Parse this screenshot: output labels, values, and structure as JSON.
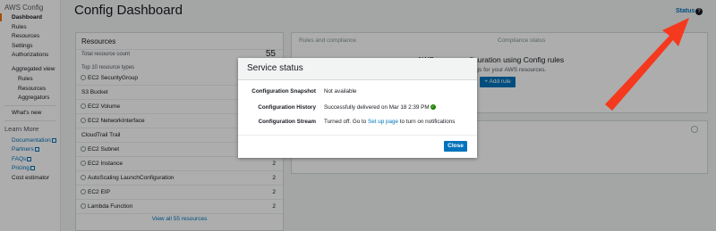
{
  "sidebar": {
    "title": "AWS Config",
    "items": [
      {
        "label": "Dashboard",
        "active": true
      },
      {
        "label": "Rules"
      },
      {
        "label": "Resources"
      },
      {
        "label": "Settings"
      },
      {
        "label": "Authorizations"
      }
    ],
    "aggregated_heading": "Aggregated view",
    "aggregated_items": [
      {
        "label": "Rules"
      },
      {
        "label": "Resources"
      },
      {
        "label": "Aggregators"
      }
    ],
    "whats_new": "What's new",
    "learn_more_heading": "Learn More",
    "learn_more_items": [
      {
        "label": "Documentation"
      },
      {
        "label": "Partners"
      },
      {
        "label": "FAQs"
      },
      {
        "label": "Pricing"
      }
    ],
    "cost_estimator": "Cost estimator"
  },
  "header": {
    "title": "Config Dashboard",
    "status_link": "Status",
    "help_icon": "?"
  },
  "resources": {
    "title": "Resources",
    "total_label": "Total resource count",
    "total_value": "55",
    "top_label": "Top 10 resource types",
    "rows": [
      {
        "name": "EC2 SecurityGroup",
        "count": "",
        "icon": "shield-icon"
      },
      {
        "name": "S3 Bucket",
        "count": "",
        "icon": ""
      },
      {
        "name": "EC2 Volume",
        "count": "",
        "icon": "volume-icon"
      },
      {
        "name": "EC2 NetworkInterface",
        "count": "",
        "icon": "network-icon"
      },
      {
        "name": "CloudTrail Trail",
        "count": "",
        "icon": ""
      },
      {
        "name": "EC2 Subnet",
        "count": "",
        "icon": "subnet-icon"
      },
      {
        "name": "EC2 Instance",
        "count": "2",
        "icon": "instance-icon"
      },
      {
        "name": "AutoScaling LaunchConfiguration",
        "count": "2",
        "icon": "autoscaling-icon"
      },
      {
        "name": "EC2 EIP",
        "count": "2",
        "icon": "eip-icon"
      },
      {
        "name": "Lambda Function",
        "count": "2",
        "icon": "lambda-icon"
      }
    ],
    "view_all": "View all 55 resources"
  },
  "right_panel": {
    "tab1": "Rules and compliance",
    "tab2": "Compliance status",
    "heading": "ource configuration using Config rules",
    "heading_prefix": "AWS",
    "subtext": "ent configuration settings for your AWS resources.",
    "add_rule_label": "Add rule"
  },
  "modal": {
    "title": "Service status",
    "rows": [
      {
        "label": "Configuration Snapshot",
        "value": "Not available"
      },
      {
        "label": "Configuration History",
        "value": "Successfully delivered on Mar 18 2:39 PM"
      },
      {
        "label": "Configuration Stream",
        "value_prefix": "Turned off. Go to",
        "value_link": "Set up page",
        "value_suffix": "to turn on notifications"
      }
    ],
    "close_label": "Close"
  },
  "colors": {
    "accent": "#0073bb",
    "active_bar": "#ec7211",
    "success": "#1d8102",
    "annotation_arrow": "#f5391e"
  }
}
